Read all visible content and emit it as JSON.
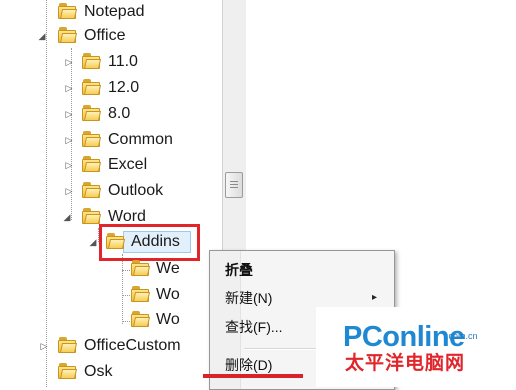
{
  "tree": {
    "nodes": [
      {
        "label": "Notepad",
        "expander": ""
      },
      {
        "label": "Office",
        "expander": "◢"
      },
      {
        "label": "11.0",
        "expander": "▷"
      },
      {
        "label": "12.0",
        "expander": "▷"
      },
      {
        "label": "8.0",
        "expander": "▷"
      },
      {
        "label": "Common",
        "expander": "▷"
      },
      {
        "label": "Excel",
        "expander": "▷"
      },
      {
        "label": "Outlook",
        "expander": "▷"
      },
      {
        "label": "Word",
        "expander": "◢"
      },
      {
        "label": "Addins",
        "expander": "◢"
      },
      {
        "label": "We",
        "expander": ""
      },
      {
        "label": "Wo",
        "expander": ""
      },
      {
        "label": "Wo",
        "expander": ""
      },
      {
        "label": "OfficeCustom",
        "expander": "▷"
      },
      {
        "label": "Osk",
        "expander": ""
      }
    ]
  },
  "context_menu": {
    "items": [
      {
        "label": "折叠",
        "bold": true
      },
      {
        "label": "新建(N)",
        "has_submenu": true
      },
      {
        "label": "查找(F)...",
        "has_submenu": false
      },
      {
        "label": "删除(D)",
        "has_submenu": false
      }
    ],
    "submenu_arrow": "▸"
  },
  "watermark": {
    "brand": "PConline",
    "domain": ".com.cn",
    "chinese": "太平洋电脑网"
  },
  "colors": {
    "highlight": "#e0252b",
    "folder": "#f0bf3c",
    "brand_blue": "#1f88d2"
  }
}
